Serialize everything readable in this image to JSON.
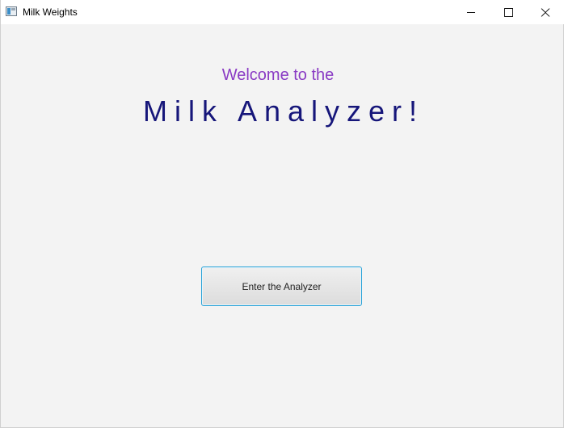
{
  "window": {
    "title": "Milk Weights",
    "controls": {
      "minimize_icon": "minimize-icon",
      "maximize_icon": "maximize-icon",
      "close_icon": "close-icon"
    }
  },
  "content": {
    "welcome_text": "Welcome to the",
    "headline": "Milk Analyzer!",
    "enter_button_label": "Enter the Analyzer"
  },
  "colors": {
    "background": "#f3f3f3",
    "welcome_text": "#8a3bc4",
    "headline": "#16167a",
    "button_border": "#2aa3d8"
  }
}
